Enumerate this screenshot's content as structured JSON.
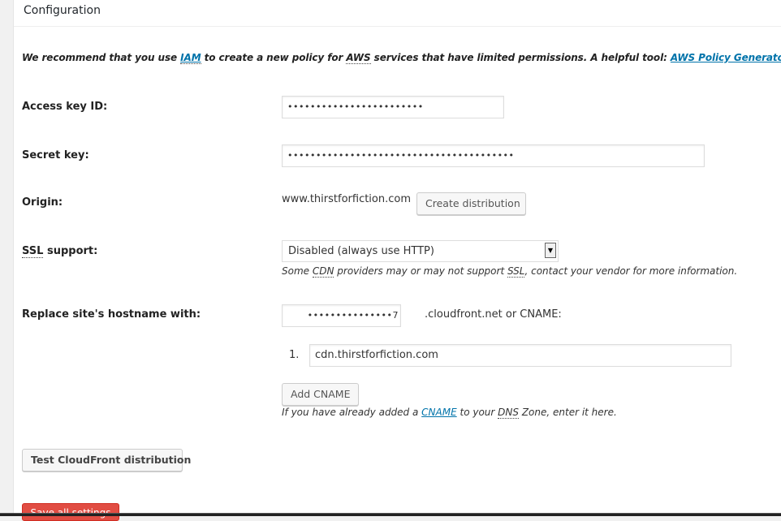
{
  "panel": {
    "title": "Configuration"
  },
  "intro": {
    "text_before": "We recommend that you use ",
    "iam_link": "IAM",
    "text_middle1": " to create a new policy for ",
    "aws_abbr": "AWS",
    "text_middle2": " services that have limited permissions. A helpful tool: ",
    "policy_link": "AWS Policy Generator"
  },
  "fields": {
    "access_key": {
      "label": "Access key ID:",
      "value": "••••••••••••••••••••••••"
    },
    "secret_key": {
      "label": "Secret key:",
      "value": "••••••••••••••••••••••••••••••••••••••••"
    },
    "origin": {
      "label": "Origin:",
      "value": "www.thirstforfiction.com",
      "button": "Create distribution"
    },
    "ssl": {
      "label_abbr": "SSL",
      "label_rest": " support:",
      "selected": "Disabled (always use HTTP)",
      "desc_before": "Some ",
      "desc_cdn": "CDN",
      "desc_middle": " providers may or may not support ",
      "desc_ssl": "SSL",
      "desc_after": ", contact your vendor for more information."
    },
    "hostname": {
      "label": "Replace site's hostname with:",
      "value": "•••••••••••••••7",
      "suffix": ".cloudfront.net or CNAME:",
      "cnames": [
        {
          "index": "1.",
          "value": "cdn.thirstforfiction.com"
        }
      ],
      "add_button": "Add CNAME",
      "desc_before": "If you have already added a ",
      "desc_link": "CNAME",
      "desc_middle": " to your ",
      "desc_dns": "DNS",
      "desc_after": " Zone, enter it here."
    }
  },
  "actions": {
    "test_button": "Test CloudFront distribution",
    "save_button": "Save all settings"
  }
}
